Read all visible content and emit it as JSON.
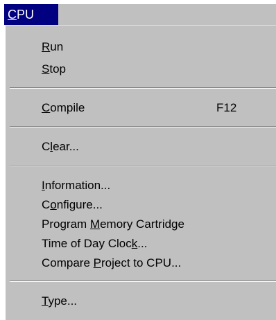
{
  "menubar": {
    "title_prefix": "",
    "title_mnemonic": "C",
    "title_suffix": "PU"
  },
  "menu": {
    "items": [
      {
        "pre": "",
        "key": "R",
        "post": "un",
        "shortcut": ""
      },
      {
        "pre": "",
        "key": "S",
        "post": "top",
        "shortcut": ""
      },
      {
        "pre": "",
        "key": "C",
        "post": "ompile",
        "shortcut": "F12"
      },
      {
        "pre": "C",
        "key": "l",
        "post": "ear...",
        "shortcut": ""
      },
      {
        "pre": "",
        "key": "I",
        "post": "nformation...",
        "shortcut": ""
      },
      {
        "pre": "C",
        "key": "o",
        "post": "nfigure...",
        "shortcut": ""
      },
      {
        "pre": "Program ",
        "key": "M",
        "post": "emory Cartridge",
        "shortcut": ""
      },
      {
        "pre": "Time of Day Cloc",
        "key": "k",
        "post": "...",
        "shortcut": ""
      },
      {
        "pre": "Compare ",
        "key": "P",
        "post": "roject to CPU...",
        "shortcut": ""
      },
      {
        "pre": "",
        "key": "T",
        "post": "ype...",
        "shortcut": ""
      }
    ]
  },
  "colors": {
    "menu_background": "#c0c0c0",
    "highlight": "#000080",
    "highlight_text": "#ffffff"
  }
}
